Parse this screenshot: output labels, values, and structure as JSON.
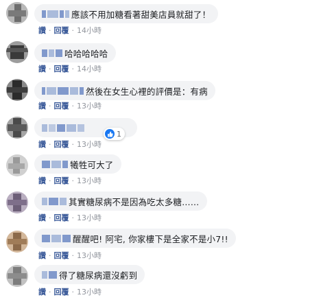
{
  "comments": [
    {
      "text": "應該不用加糖看著甜美店員就甜了！",
      "actions": {
        "like": "讚",
        "reply": "回覆",
        "time": "14小時"
      }
    },
    {
      "text": "哈哈哈哈哈",
      "actions": {
        "like": "讚",
        "reply": "回覆",
        "time": "14小時"
      }
    },
    {
      "text": "然後在女生心裡的評價是：有病",
      "actions": {
        "like": "讚",
        "reply": "回覆",
        "time": "13小時"
      }
    },
    {
      "text": "",
      "reaction_count": "1",
      "actions": {
        "like": "讚",
        "reply": "回覆",
        "time": "13小時"
      }
    },
    {
      "text": "犧牲可大了",
      "actions": {
        "like": "讚",
        "reply": "回覆",
        "time": "13小時"
      }
    },
    {
      "text": "其實糖尿病不是因為吃太多糖……",
      "actions": {
        "like": "讚",
        "reply": "回覆",
        "time": "13小時"
      }
    },
    {
      "text": "醒醒吧! 阿宅, 你家樓下是全家不是小7!!",
      "actions": {
        "like": "讚",
        "reply": "回覆",
        "time": "13小時"
      }
    },
    {
      "text": "得了糖尿病還沒虧到",
      "actions": {
        "like": "讚",
        "reply": "回覆",
        "time": "13小時"
      }
    }
  ],
  "colors": {
    "link": "#385898",
    "bubble": "#f2f3f5",
    "like_blue": "#1877f2"
  }
}
